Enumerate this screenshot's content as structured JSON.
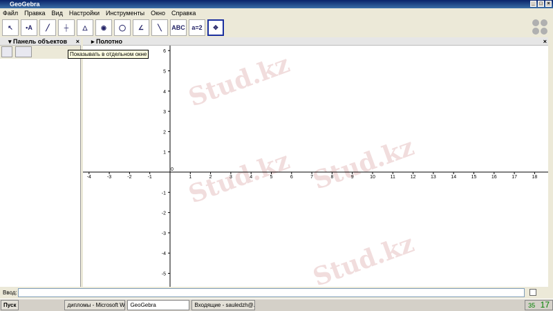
{
  "window": {
    "title": "GeoGebra"
  },
  "menu": [
    "Файл",
    "Правка",
    "Вид",
    "Настройки",
    "Инструменты",
    "Окно",
    "Справка"
  ],
  "tools": [
    {
      "icon": "move-icon",
      "label": "↖"
    },
    {
      "icon": "point-icon",
      "label": "•A"
    },
    {
      "icon": "line-icon",
      "label": "╱"
    },
    {
      "icon": "perpendicular-icon",
      "label": "┼"
    },
    {
      "icon": "polygon-icon",
      "label": "△"
    },
    {
      "icon": "circle-icon",
      "label": "◉"
    },
    {
      "icon": "conic-icon",
      "label": "◯"
    },
    {
      "icon": "angle-icon",
      "label": "∠"
    },
    {
      "icon": "reflect-icon",
      "label": "╲"
    },
    {
      "icon": "text-icon",
      "label": "ABC"
    },
    {
      "icon": "slider-icon",
      "label": "a=2"
    },
    {
      "icon": "move-view-icon",
      "label": "✥"
    }
  ],
  "left_panel": {
    "title": "Панель объектов"
  },
  "tooltip": "Показывать в отдельном окне",
  "canvas": {
    "title": "Полотно",
    "x_min": -4,
    "x_max": 18,
    "y_min": -5,
    "y_max": 6
  },
  "watermark": "Stud.kz",
  "input": {
    "label": "Ввод:",
    "value": ""
  },
  "taskbar": {
    "start": "Пуск",
    "items": [
      "дипломы - Microsoft Wo...",
      "GeoGebra",
      "Входящие - sauledzh@..."
    ],
    "tray": "35",
    "clock": "17"
  }
}
